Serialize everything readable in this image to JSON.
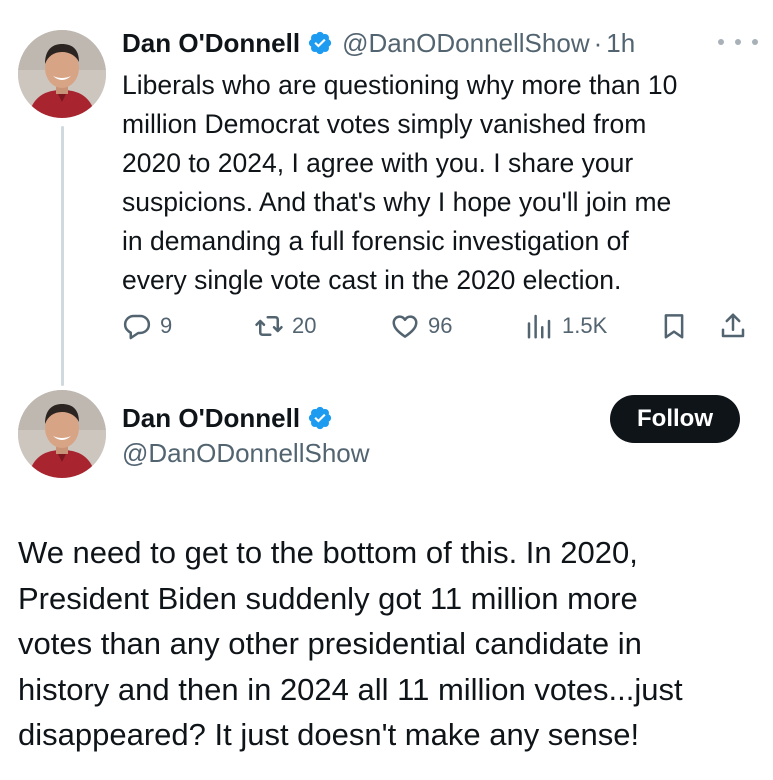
{
  "tweet1": {
    "author_name": "Dan O'Donnell",
    "handle": "@DanODonnellShow",
    "separator": "·",
    "time": "1h",
    "text": "Liberals who are  questioning why more than 10\nmillion Democrat votes simply vanished from\n2020 to 2024, I agree with you. I share your\nsuspicions. And that's why I hope you'll join me\nin demanding a full forensic investigation of\nevery single vote cast in the 2020 election.",
    "replies": "9",
    "reposts": "20",
    "likes": "96",
    "views": "1.5K",
    "icons": [
      "more-icon",
      "reply-icon",
      "repost-icon",
      "like-icon",
      "views-icon",
      "bookmark-icon",
      "share-icon",
      "verified-badge-icon"
    ]
  },
  "tweet2": {
    "author_name": "Dan O'Donnell",
    "handle": "@DanODonnellShow",
    "follow_label": "Follow",
    "text": "We need to get to the bottom of this. In 2020,\nPresident Biden suddenly got 11 million more\nvotes than any other presidential candidate in\nhistory and then in 2024 all 11 million votes...just\ndisappeared? It just doesn't make any sense!"
  },
  "colors": {
    "text": "#0f1419",
    "secondary": "#536471",
    "verified_blue": "#1d9bf0",
    "follow_bg": "#0f1419",
    "thread_line": "#cfd9de"
  }
}
